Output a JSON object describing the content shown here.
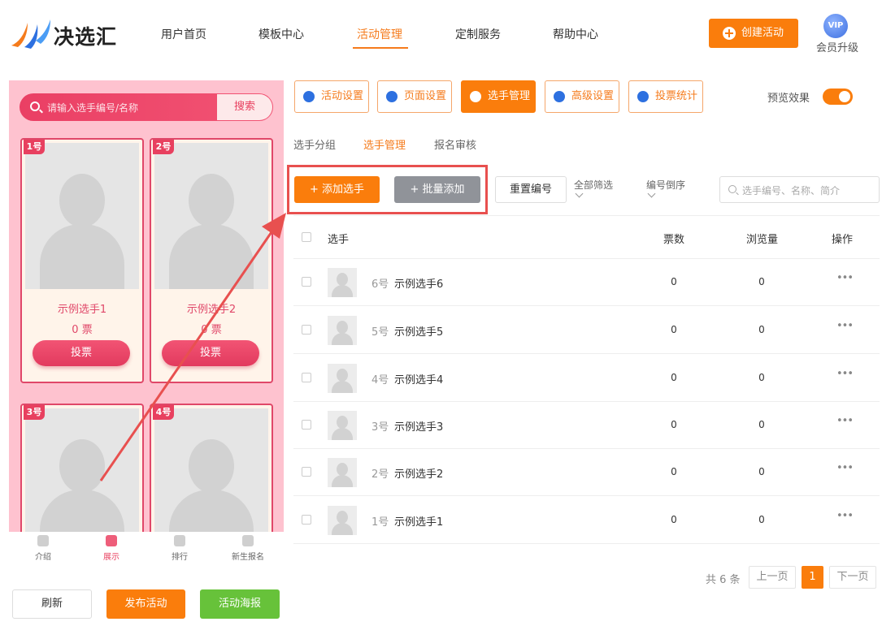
{
  "brand": {
    "name": "决选汇"
  },
  "nav": {
    "items": [
      "用户首页",
      "模板中心",
      "活动管理",
      "定制服务",
      "帮助中心"
    ],
    "active": "活动管理"
  },
  "header": {
    "create_label": "创建活动",
    "vip_badge": "VIP",
    "vip_label": "会员升级"
  },
  "preview": {
    "search_placeholder": "请输入选手编号/名称",
    "search_button": "搜索",
    "cards": [
      {
        "tag": "1号",
        "name": "示例选手1",
        "votes": "0 票",
        "vote_label": "投票"
      },
      {
        "tag": "2号",
        "name": "示例选手2",
        "votes": "0 票",
        "vote_label": "投票"
      },
      {
        "tag": "3号"
      },
      {
        "tag": "4号"
      }
    ],
    "tabbar": [
      "介绍",
      "展示",
      "排行",
      "新生报名"
    ],
    "tabbar_active": "展示"
  },
  "left_actions": {
    "refresh": "刷新",
    "publish": "发布活动",
    "poster": "活动海报"
  },
  "toolbar": {
    "buttons": [
      "活动设置",
      "页面设置",
      "选手管理",
      "高级设置",
      "投票统计"
    ],
    "active": "选手管理",
    "preview_label": "预览效果",
    "preview_on": true
  },
  "subtabs": {
    "items": [
      "选手分组",
      "选手管理",
      "报名审核"
    ],
    "active": "选手管理"
  },
  "actions": {
    "add": "添加选手",
    "batch_add": "批量添加",
    "reset_numbers": "重置编号",
    "filter_all": "全部筛选",
    "sort": "编号倒序",
    "search_placeholder": "选手编号、名称、简介"
  },
  "table": {
    "headers": {
      "player": "选手",
      "votes": "票数",
      "views": "浏览量",
      "ops": "操作"
    },
    "rows": [
      {
        "num": "6号",
        "name": "示例选手6",
        "votes": "0",
        "views": "0",
        "more": "•••"
      },
      {
        "num": "5号",
        "name": "示例选手5",
        "votes": "0",
        "views": "0",
        "more": "•••"
      },
      {
        "num": "4号",
        "name": "示例选手4",
        "votes": "0",
        "views": "0",
        "more": "•••"
      },
      {
        "num": "3号",
        "name": "示例选手3",
        "votes": "0",
        "views": "0",
        "more": "•••"
      },
      {
        "num": "2号",
        "name": "示例选手2",
        "votes": "0",
        "views": "0",
        "more": "•••"
      },
      {
        "num": "1号",
        "name": "示例选手1",
        "votes": "0",
        "views": "0",
        "more": "•••"
      }
    ]
  },
  "pagination": {
    "total": "共 6 条",
    "prev": "上一页",
    "current": "1",
    "next": "下一页"
  },
  "colors": {
    "accent": "#fa7d0c",
    "pink": "#fec2cf",
    "vote": "#e8405f",
    "annotation": "#e8504f",
    "green": "#67c23a"
  }
}
